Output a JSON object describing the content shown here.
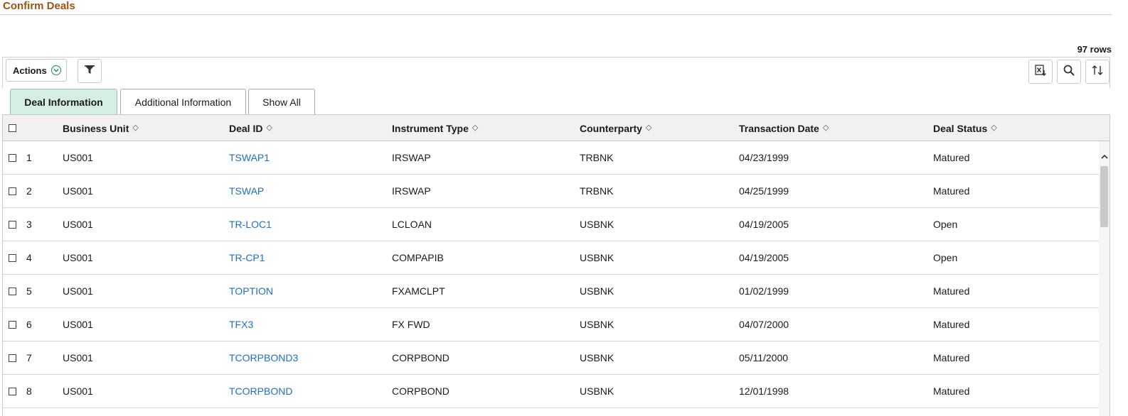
{
  "page": {
    "title": "Confirm Deals",
    "row_count": "97 rows"
  },
  "toolbar": {
    "actions_label": "Actions",
    "icons": {
      "actions_chevron": "chevron-down-icon",
      "filter": "filter-icon",
      "export": "excel-export-icon",
      "search": "search-icon",
      "sort": "sort-icon"
    }
  },
  "tabs": [
    {
      "label": "Deal Information",
      "active": true
    },
    {
      "label": "Additional Information",
      "active": false
    },
    {
      "label": "Show All",
      "active": false
    }
  ],
  "grid": {
    "columns": [
      "Business Unit",
      "Deal ID",
      "Instrument Type",
      "Counterparty",
      "Transaction Date",
      "Deal Status"
    ],
    "rows": [
      {
        "num": "1",
        "business_unit": "US001",
        "deal_id": "TSWAP1",
        "instrument_type": "IRSWAP",
        "counterparty": "TRBNK",
        "transaction_date": "04/23/1999",
        "deal_status": "Matured"
      },
      {
        "num": "2",
        "business_unit": "US001",
        "deal_id": "TSWAP",
        "instrument_type": "IRSWAP",
        "counterparty": "TRBNK",
        "transaction_date": "04/25/1999",
        "deal_status": "Matured"
      },
      {
        "num": "3",
        "business_unit": "US001",
        "deal_id": "TR-LOC1",
        "instrument_type": "LCLOAN",
        "counterparty": "USBNK",
        "transaction_date": "04/19/2005",
        "deal_status": "Open"
      },
      {
        "num": "4",
        "business_unit": "US001",
        "deal_id": "TR-CP1",
        "instrument_type": "COMPAPIB",
        "counterparty": "USBNK",
        "transaction_date": "04/19/2005",
        "deal_status": "Open"
      },
      {
        "num": "5",
        "business_unit": "US001",
        "deal_id": "TOPTION",
        "instrument_type": "FXAMCLPT",
        "counterparty": "USBNK",
        "transaction_date": "01/02/1999",
        "deal_status": "Matured"
      },
      {
        "num": "6",
        "business_unit": "US001",
        "deal_id": "TFX3",
        "instrument_type": "FX FWD",
        "counterparty": "USBNK",
        "transaction_date": "04/07/2000",
        "deal_status": "Matured"
      },
      {
        "num": "7",
        "business_unit": "US001",
        "deal_id": "TCORPBOND3",
        "instrument_type": "CORPBOND",
        "counterparty": "USBNK",
        "transaction_date": "05/11/2000",
        "deal_status": "Matured"
      },
      {
        "num": "8",
        "business_unit": "US001",
        "deal_id": "TCORPBOND",
        "instrument_type": "CORPBOND",
        "counterparty": "USBNK",
        "transaction_date": "12/01/1998",
        "deal_status": "Matured"
      }
    ]
  },
  "colors": {
    "title": "#a0520f",
    "link": "#1f6fc4",
    "active_tab": "#d4efe0",
    "accent_green": "#1f8a4c"
  }
}
